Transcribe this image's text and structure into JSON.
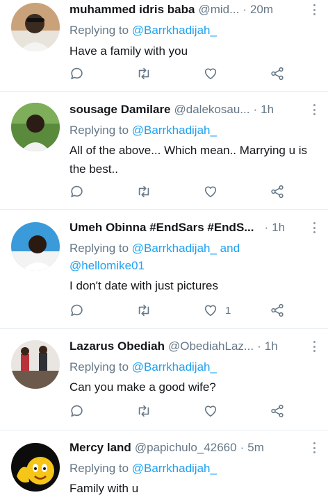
{
  "tweets": [
    {
      "name": "muhammed idris baba",
      "handle": "@mid...",
      "time": "20m",
      "replying_prefix": "Replying to ",
      "mentions": "@Barrkhadijah_",
      "mentions_extra": "",
      "text": "Have a family with you",
      "like_count": ""
    },
    {
      "name": "sousage Damilare",
      "handle": "@dalekosau...",
      "time": "1h",
      "replying_prefix": "Replying to ",
      "mentions": "@Barrkhadijah_",
      "mentions_extra": "",
      "text": "All of the above... Which mean.. Marrying u is the best..",
      "like_count": ""
    },
    {
      "name": "Umeh Obinna #EndSars #EndS...",
      "handle": "",
      "time": "1h",
      "replying_prefix": "Replying to ",
      "mentions": "@Barrkhadijah_ and",
      "mentions_extra": "@hellomike01",
      "text": "I don't date with just pictures",
      "like_count": "1"
    },
    {
      "name": "Lazarus Obediah",
      "handle": "@ObediahLaz...",
      "time": "1h",
      "replying_prefix": "Replying to ",
      "mentions": "@Barrkhadijah_",
      "mentions_extra": "",
      "text": "Can you make a good wife?",
      "like_count": ""
    },
    {
      "name": "Mercy land",
      "handle": "@papichulo_42660",
      "time": "5m",
      "replying_prefix": "Replying to ",
      "mentions": "@Barrkhadijah_",
      "mentions_extra": "",
      "text": "Family with u",
      "like_count": ""
    }
  ],
  "separator": "·",
  "icons": {
    "reply": "reply-icon",
    "retweet": "retweet-icon",
    "like": "heart-icon",
    "share": "share-icon",
    "more": "more-vertical-icon"
  },
  "colors": {
    "name": "#14171a",
    "secondary": "#657786",
    "link": "#1da1f2",
    "divider": "#e6ecf0"
  }
}
